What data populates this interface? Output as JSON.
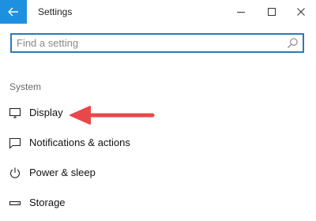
{
  "window": {
    "title": "Settings",
    "back_icon": "arrow-left-icon",
    "controls": [
      "minimize-icon",
      "maximize-icon",
      "close-icon"
    ],
    "accent_color": "#1e90e0"
  },
  "search": {
    "placeholder": "Find a setting",
    "value": "",
    "icon": "search-icon",
    "border_color": "#2a7ab9"
  },
  "sidebar": {
    "section_label": "System",
    "items": [
      {
        "label": "Display",
        "icon": "monitor-icon"
      },
      {
        "label": "Notifications & actions",
        "icon": "notification-icon"
      },
      {
        "label": "Power & sleep",
        "icon": "power-icon"
      },
      {
        "label": "Storage",
        "icon": "storage-icon"
      }
    ]
  },
  "annotation": {
    "type": "arrow",
    "points_to": "Display",
    "color": "#e8484a"
  }
}
